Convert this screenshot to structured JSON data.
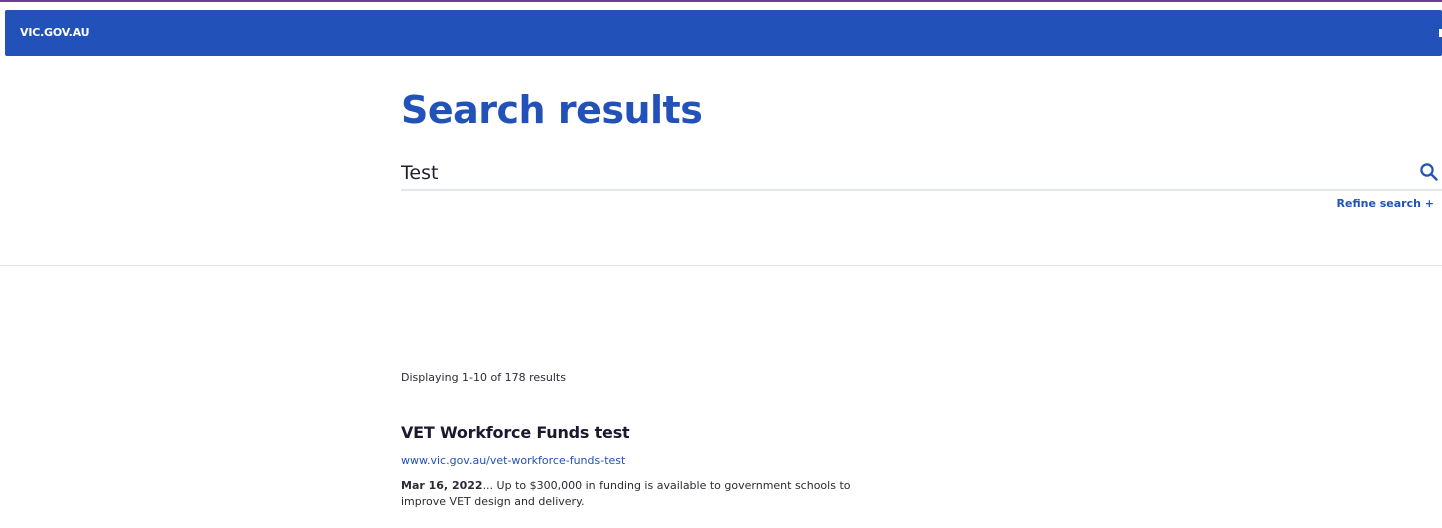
{
  "header": {
    "brand": "VIC.GOV.AU",
    "background_color": "#2151b9"
  },
  "page": {
    "title": "Search results"
  },
  "search": {
    "value": "Test",
    "icon": "search-icon",
    "refine_label": "Refine search +"
  },
  "results": {
    "summary": "Displaying 1-10 of 178 results",
    "items": [
      {
        "title": "VET Workforce Funds test",
        "url": "www.vic.gov.au/vet-workforce-funds-test",
        "date": "Mar 16, 2022",
        "snippet": "... Up to $300,000 in funding is available to government schools to improve VET design and delivery."
      }
    ]
  },
  "colors": {
    "accent": "#2151b9",
    "top_stripe": "#6b3b9e",
    "divider": "#e3e6ea"
  }
}
